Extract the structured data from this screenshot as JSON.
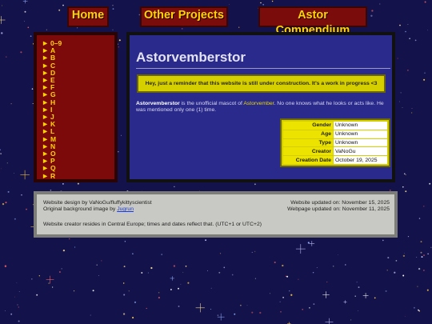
{
  "nav": {
    "home": "Home",
    "other_projects": "Other Projects",
    "compendium": "Astor Compendium"
  },
  "sidebar": {
    "marker": "▶",
    "items": [
      "0–9",
      "A",
      "B",
      "C",
      "D",
      "E",
      "F",
      "G",
      "H",
      "I",
      "J",
      "K",
      "L",
      "M",
      "N",
      "O",
      "P",
      "Q",
      "R"
    ]
  },
  "page": {
    "title": "Astorvemberstor",
    "notice": "Hey, just a reminder that this website is still under construction. It's a work in progress <3",
    "description": {
      "subject": "Astorvemberstor",
      "text_1": " is the unofficial mascot of ",
      "link": "Astorvember",
      "text_2": ". No one knows what he looks or acts like. He was mentioned only one (1) time."
    },
    "info": [
      {
        "key": "Gender",
        "value": "Unknown"
      },
      {
        "key": "Age",
        "value": "Unknown"
      },
      {
        "key": "Type",
        "value": "Unknown"
      },
      {
        "key": "Creator",
        "value": "VaNoGu"
      },
      {
        "key": "Creation Date",
        "value": "October 19, 2025"
      }
    ]
  },
  "footer": {
    "design_credit": "Website design by VaNoGu/fluffykittyscientist",
    "bg_credit_prefix": "Original background image by ",
    "bg_credit_link": "Jugrun",
    "site_updated": "Website updated on: November 15, 2025",
    "page_updated": "Webpage updated on: November 11, 2025",
    "timezone_note": "Website creator resides in Central Europe; times and dates reflect that. (UTC+1 or UTC+2)"
  },
  "colors": {
    "background": "#14124a",
    "nav_bg": "#7a0c0c",
    "nav_text": "#ffd500",
    "main_bg": "#2a2a8c",
    "notice_bg": "#d6cf00",
    "footer_bg": "#c8c8c4"
  }
}
